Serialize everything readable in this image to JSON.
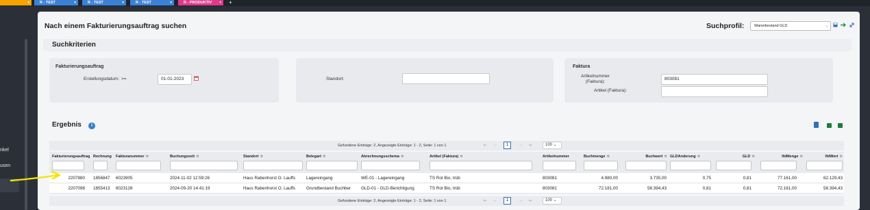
{
  "tabs": [
    {
      "label": "R - TEST"
    },
    {
      "label": "R - TEST"
    },
    {
      "label": "R - TEST"
    },
    {
      "label": "R - PRODUKTIV"
    }
  ],
  "tab_add": "+",
  "sidebar": {
    "items": [
      {
        "label": "nkel"
      },
      {
        "label": "usen"
      }
    ]
  },
  "page": {
    "title": "Nach einem Fakturierungsauftrag suchen",
    "profile_label": "Suchprofil:",
    "profile_value": "Warenbestand GLD"
  },
  "criteria": {
    "title": "Suchkriterien",
    "card1": {
      "title": "Fakturierungsauftrag",
      "date_label": "Erstellungsdatum:",
      "operator": ">=",
      "date_value": "01-01-2023"
    },
    "card2": {
      "standort_label": "Standort:",
      "standort_value": ""
    },
    "card3": {
      "title": "Faktura",
      "artnr_label_1": "Artikelnummer",
      "artnr_label_2": "(Faktura):",
      "artnr_value": "803081",
      "artikel_label": "Artikel (Faktura):",
      "artikel_value": ""
    }
  },
  "results": {
    "title": "Ergebnis",
    "info_icon": "i",
    "pager_text": "Gefundene Einträge: 2, Angezeigte Einträge: 1 - 2, Seite: 1 von 1",
    "page_number": "1",
    "page_size": "100",
    "nav_first": "⇤",
    "nav_prev": "←",
    "nav_next": "→",
    "nav_last": "⇥",
    "sort_glyph": "≎",
    "chevron": "⌄",
    "columns": [
      {
        "label": "Fakturierungsauftrag"
      },
      {
        "label": "Rechnung"
      },
      {
        "label": "Fakturanummer"
      },
      {
        "label": "Buchungszeit"
      },
      {
        "label": "Standort"
      },
      {
        "label": "Belegart"
      },
      {
        "label": "Abrechnungsschema"
      },
      {
        "label": "Artikel (Faktura)"
      },
      {
        "label": "Artikelnummer"
      },
      {
        "label": "Buchmenge"
      },
      {
        "label": "Buchwert"
      },
      {
        "label": "GLDÄnderung"
      },
      {
        "label": "GLD"
      },
      {
        "label": "lfdMenge"
      },
      {
        "label": "lfdWert"
      }
    ],
    "rows": [
      [
        "2207880",
        "1856847",
        "6023905",
        "2024-11-02 12:59:26",
        "Haus Rabenhorst O. Lauffs",
        "Lagereingang",
        "WE-01 - Lagereingang",
        "TS Rot Bio, trüb",
        "803081",
        "4.980,00",
        "3.735,00",
        "0,75",
        "0,81",
        "77.161,00",
        "62.129,43"
      ],
      [
        "2207098",
        "1855413",
        "6023128",
        "2024-09-20 14:41:19",
        "Haus Rabenhorst O. Lauffs",
        "Grundbestand Buchber",
        "GLD-01 - GLD-Berichtigung",
        "TS Rot Bio, trüb",
        "803081",
        "72.181,00",
        "58.394,43",
        "0,81",
        "0,81",
        "72.181,00",
        "58.394,43"
      ]
    ]
  },
  "colors": {
    "accent": "#2f7ed8",
    "annotation_arrow": "#f2e600",
    "excel_green": "#1e7a3c"
  }
}
